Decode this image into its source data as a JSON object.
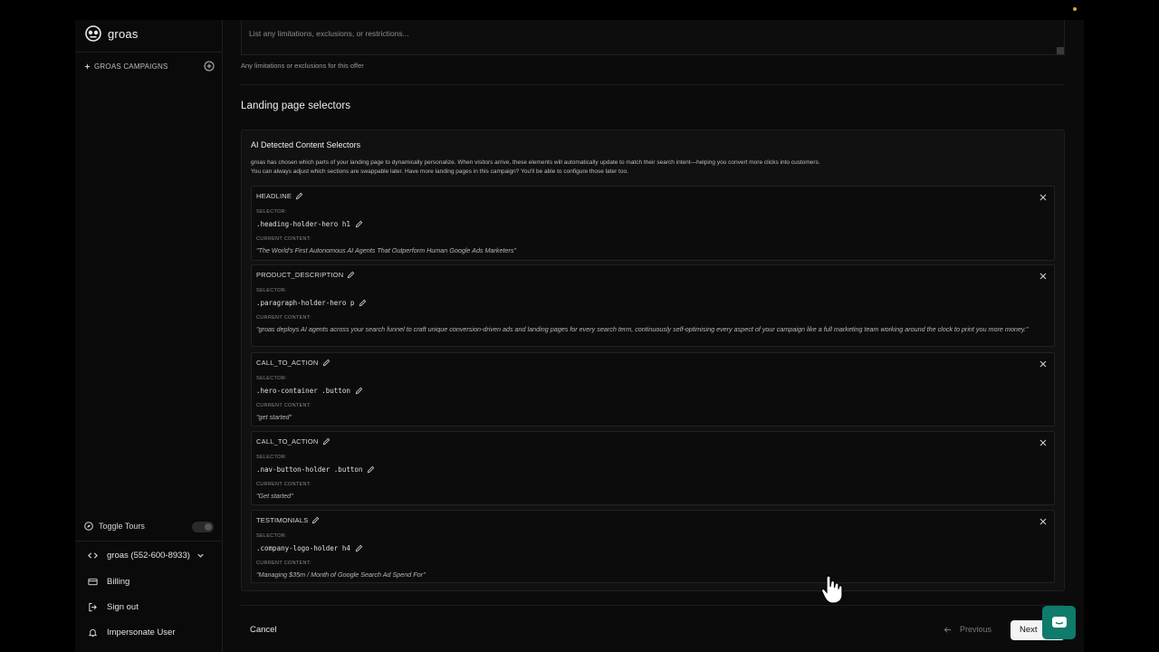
{
  "brand": {
    "name": "groas"
  },
  "sidebar": {
    "campaigns_label": "GROAS CAMPAIGNS",
    "toggle_tours": "Toggle Tours",
    "account": "groas (552-600-8933)",
    "billing": "Billing",
    "sign_out": "Sign out",
    "impersonate": "Impersonate User"
  },
  "form": {
    "limitations_placeholder": "List any limitations, exclusions, or restrictions...",
    "limitations_help": "Any limitations or exclusions for this offer"
  },
  "landing": {
    "section_title": "Landing page selectors",
    "panel_title": "AI Detected Content Selectors",
    "panel_desc_1": "groas has chosen which parts of your landing page to dynamically personalize. When visitors arrive, these elements will automatically update to match their search intent—helping you convert more clicks into customers.",
    "panel_desc_2": "You can always adjust which sections are swappable later. Have more landing pages in this campaign? You'll be able to configure those later too.",
    "selector_caption": "SELECTOR:",
    "content_caption": "CURRENT CONTENT:",
    "items": [
      {
        "label": "HEADLINE",
        "selector": ".heading-holder-hero h1",
        "content": "\"The World's First Autonomous AI Agents That Outperform Human Google Ads Marketers\""
      },
      {
        "label": "PRODUCT_DESCRIPTION",
        "selector": ".paragraph-holder-hero p",
        "content": "\"groas deploys AI agents across your search funnel to craft unique conversion-driven ads and landing pages for every search term, continuously self-optimising every aspect of your campaign like a full marketing team working around the clock to print you more money.\""
      },
      {
        "label": "CALL_TO_ACTION",
        "selector": ".hero-container .button",
        "content": "\"get started\""
      },
      {
        "label": "CALL_TO_ACTION",
        "selector": ".nav-button-holder .button",
        "content": "\"Get started\""
      },
      {
        "label": "TESTIMONIALS",
        "selector": ".company-logo-holder h4",
        "content": "\"Managing $35m / Month of Google Search Ad Spend For\""
      }
    ]
  },
  "footer": {
    "cancel": "Cancel",
    "previous": "Previous",
    "next": "Next"
  }
}
